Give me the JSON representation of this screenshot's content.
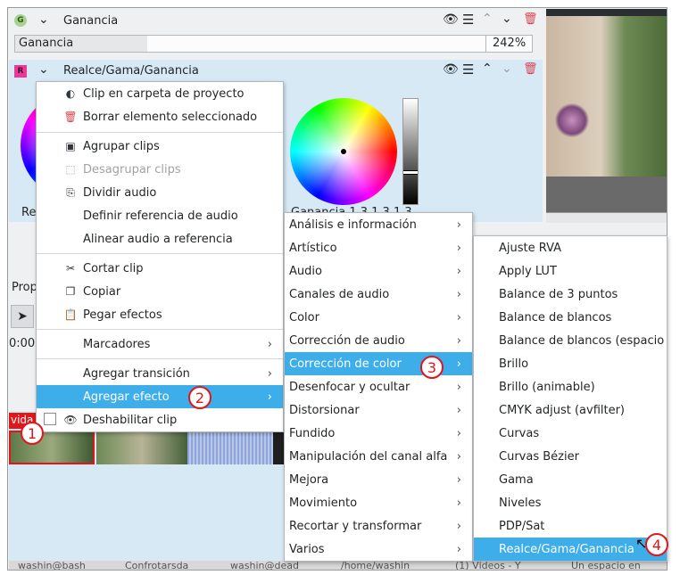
{
  "effects": {
    "gain": {
      "badge": "G",
      "title": "Ganancia",
      "param_label": "Ganancia",
      "param_value": "242%",
      "fill_fraction": 0.28
    },
    "lgg": {
      "badge": "R",
      "title": "Realce/Gama/Ganancia",
      "left_label": "Re",
      "wheel_label": "Ganancia 1.3,1.3,1.3"
    }
  },
  "side_labels": {
    "properties_tab": "Prop",
    "time": "0:00",
    "track_tag": "vida"
  },
  "context_menu": {
    "items": [
      {
        "label": "Clip en carpeta de proyecto",
        "icon": "folder-clip-icon"
      },
      {
        "label": "Borrar elemento seleccionado",
        "icon": "trash-icon"
      },
      {
        "label": "Agrupar clips",
        "icon": "group-icon"
      },
      {
        "label": "Desagrupar clips",
        "icon": "ungroup-icon",
        "disabled": true
      },
      {
        "label": "Dividir audio",
        "icon": "split-audio-icon"
      },
      {
        "label": "Definir referencia de audio"
      },
      {
        "label": "Alinear audio a referencia"
      },
      {
        "label": "Cortar clip",
        "icon": "scissors-icon"
      },
      {
        "label": "Copiar",
        "icon": "copy-icon"
      },
      {
        "label": "Pegar efectos",
        "icon": "paste-icon"
      },
      {
        "label": "Marcadores",
        "submenu": true
      },
      {
        "label": "Agregar transición",
        "submenu": true
      },
      {
        "label": "Agregar efecto",
        "submenu": true,
        "highlighted": true
      },
      {
        "label": "Deshabilitar clip",
        "icon": "eye-icon",
        "checkbox": false
      }
    ]
  },
  "category_menu": {
    "items": [
      "Análisis e información",
      "Artístico",
      "Audio",
      "Canales de audio",
      "Color",
      "Corrección de audio",
      "Corrección de color",
      "Desenfocar y ocultar",
      "Distorsionar",
      "Fundido",
      "Manipulación del canal alfa",
      "Mejora",
      "Movimiento",
      "Recortar y transformar",
      "Varios"
    ],
    "highlighted_index": 6
  },
  "effect_menu": {
    "items": [
      "Ajuste RVA",
      "Apply LUT",
      "Balance de 3 puntos",
      "Balance de blancos",
      "Balance de blancos (espacio",
      "Brillo",
      "Brillo (animable)",
      "CMYK adjust (avfilter)",
      "Curvas",
      "Curvas Bézier",
      "Gama",
      "Niveles",
      "PDP/Sat",
      "Realce/Gama/Ganancia"
    ],
    "highlighted_index": 13
  },
  "step_badges": [
    "1",
    "2",
    "3",
    "4"
  ],
  "taskbar": [
    "washin@bash",
    "Confrotarsda",
    "washin@dead",
    "/home/washin",
    "(1) Vídeos - Y",
    "Un espacio en"
  ],
  "colors": {
    "accent": "#3daee9",
    "annotation": "#e0161b",
    "panel": "#d6e9f5"
  }
}
